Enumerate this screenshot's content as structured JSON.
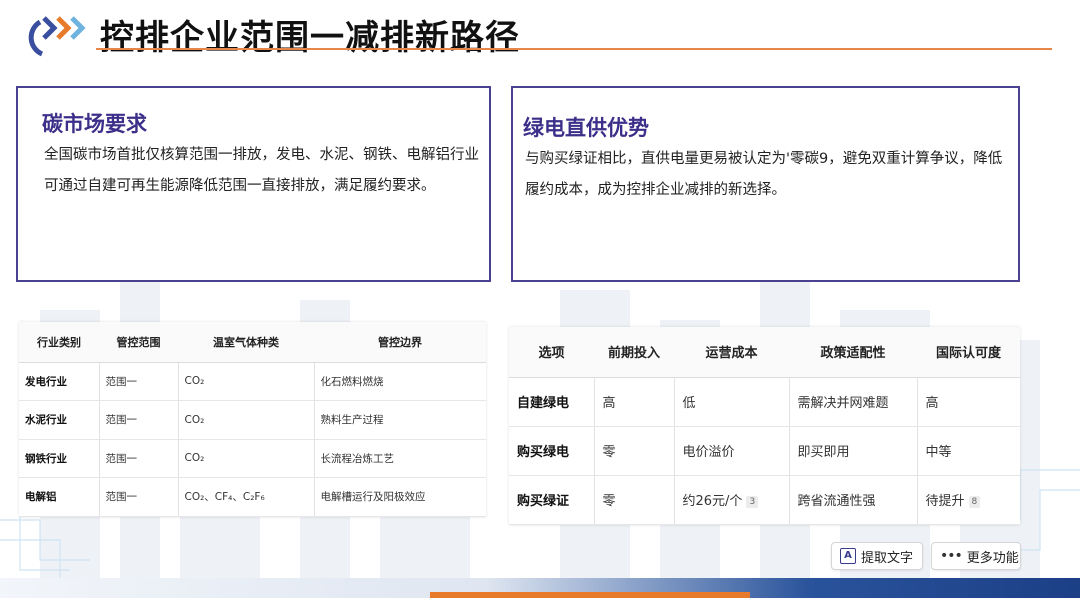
{
  "header": {
    "title": "控排企业范围一减排新路径"
  },
  "colors": {
    "accent_purple": "#3c2f8a",
    "accent_orange": "#e8864a",
    "brand_blue": "#29539b"
  },
  "cards": {
    "left": {
      "title": "碳市场要求",
      "body": "全国碳市场首批仅核算范围一排放，发电、水泥、钢铁、电解铝行业可通过自建可再生能源降低范围一直接排放，满足履约要求。"
    },
    "right": {
      "title": "绿电直供优势",
      "body": "与购买绿证相比，直供电量更易被认定为'零碳9，避免双重计算争议，降低履约成本，成为控排企业减排的新选择。"
    }
  },
  "table_left": {
    "headers": [
      "行业类别",
      "管控范围",
      "温室气体种类",
      "管控边界"
    ],
    "rows": [
      [
        "发电行业",
        "范围一",
        "CO₂",
        "化石燃料燃烧"
      ],
      [
        "水泥行业",
        "范围一",
        "CO₂",
        "熟料生产过程"
      ],
      [
        "钢铁行业",
        "范围一",
        "CO₂",
        "长流程冶炼工艺"
      ],
      [
        "电解铝",
        "范围一",
        "CO₂、CF₄、C₂F₆",
        "电解槽运行及阳极效应"
      ]
    ]
  },
  "table_right": {
    "headers": [
      "选项",
      "前期投入",
      "运营成本",
      "政策适配性",
      "国际认可度"
    ],
    "rows": [
      [
        "自建绿电",
        "高",
        "低",
        "需解决并网难题",
        "高"
      ],
      [
        "购买绿电",
        "零",
        "电价溢价",
        "即买即用",
        "中等"
      ],
      [
        "购买绿证",
        "零",
        "约26元/个",
        "跨省流通性强",
        "待提升"
      ]
    ],
    "citations": {
      "cost": "3",
      "recognition": "8"
    }
  },
  "tools": {
    "extract_text": "提取文字",
    "more_functions": "更多功能",
    "extract_icon": "A",
    "more_icon": "•••"
  }
}
